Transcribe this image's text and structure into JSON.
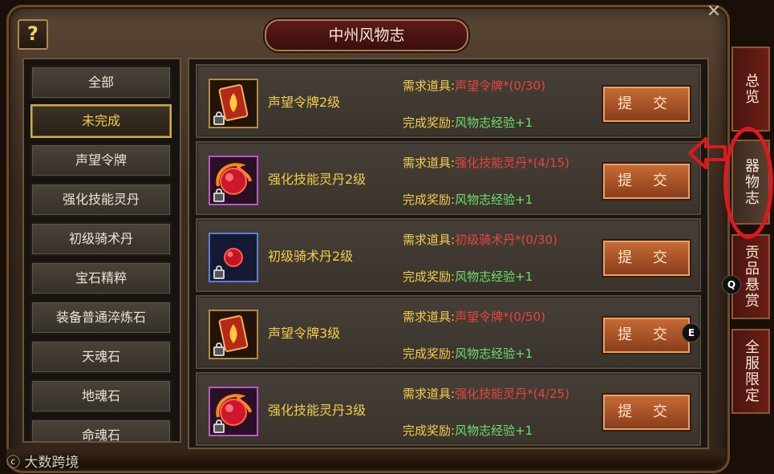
{
  "window": {
    "title": "中州风物志",
    "help_label": "?",
    "close_label": "✕"
  },
  "categories": [
    {
      "label": "全部",
      "selected": false
    },
    {
      "label": "未完成",
      "selected": true
    },
    {
      "label": "声望令牌",
      "selected": false
    },
    {
      "label": "强化技能灵丹",
      "selected": false
    },
    {
      "label": "初级骑术丹",
      "selected": false
    },
    {
      "label": "宝石精粹",
      "selected": false
    },
    {
      "label": "装备普通淬炼石",
      "selected": false
    },
    {
      "label": "天魂石",
      "selected": false
    },
    {
      "label": "地魂石",
      "selected": false
    },
    {
      "label": "命魂石",
      "selected": false
    }
  ],
  "labels": {
    "required": "需求道具:",
    "reward": "完成奖励:",
    "submit": "提 交"
  },
  "rows": [
    {
      "name": "声望令牌2级",
      "icon": "token-card-icon",
      "quality": "gold",
      "required": "声望令牌*(0/30)",
      "reward": "风物志经验+1"
    },
    {
      "name": "强化技能灵丹2级",
      "icon": "red-pill-icon",
      "quality": "purple",
      "required": "强化技能灵丹*(4/15)",
      "reward": "风物志经验+1"
    },
    {
      "name": "初级骑术丹2级",
      "icon": "riding-pill-icon",
      "quality": "blue",
      "required": "初级骑术丹*(0/30)",
      "reward": "风物志经验+1"
    },
    {
      "name": "声望令牌3级",
      "icon": "token-card-icon",
      "quality": "gold",
      "required": "声望令牌*(0/50)",
      "reward": "风物志经验+1"
    },
    {
      "name": "强化技能灵丹3级",
      "icon": "red-pill-icon",
      "quality": "purple",
      "required": "强化技能灵丹*(4/25)",
      "reward": "风物志经验+1"
    }
  ],
  "side_tabs": [
    {
      "label": "总览",
      "active": false
    },
    {
      "label": "器物志",
      "active": true
    },
    {
      "label": "贡品悬赏",
      "active": false
    },
    {
      "label": "全服限定",
      "active": false
    }
  ],
  "hotkeys": {
    "q": "Q",
    "e": "E"
  },
  "watermark": "大数跨境",
  "colors": {
    "gold_text": "#f3cc4a",
    "required_value": "#e8443c",
    "reward_value": "#6de06a",
    "annotation": "#e0171d"
  }
}
